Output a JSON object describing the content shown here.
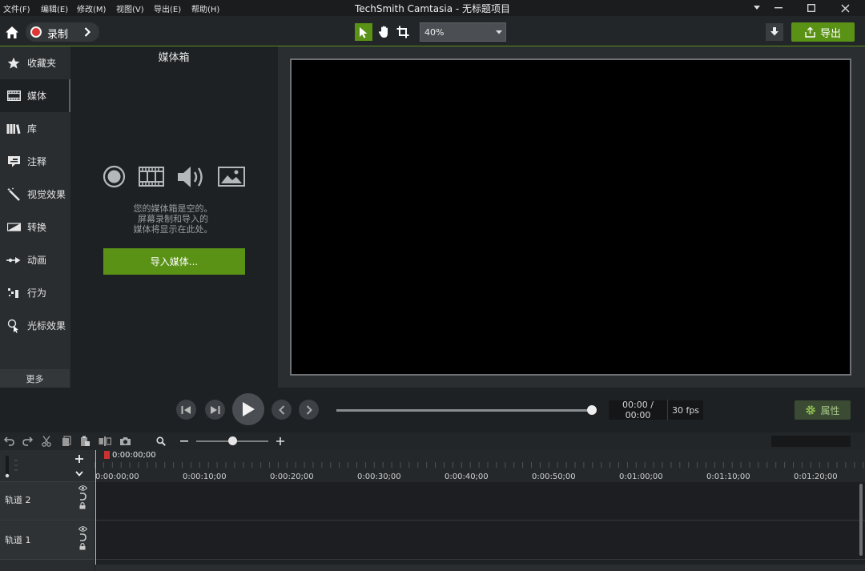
{
  "app": {
    "title": "TechSmith Camtasia - 无标题项目"
  },
  "menu": [
    "文件(F)",
    "编辑(E)",
    "修改(M)",
    "视图(V)",
    "导出(E)",
    "帮助(H)"
  ],
  "toolbar": {
    "record_label": "录制",
    "zoom_value": "40%",
    "export_label": "导出"
  },
  "rail": {
    "items": [
      {
        "label": "收藏夹",
        "icon": "star-icon"
      },
      {
        "label": "媒体",
        "icon": "film-icon"
      },
      {
        "label": "库",
        "icon": "library-icon"
      },
      {
        "label": "注释",
        "icon": "annotation-icon"
      },
      {
        "label": "视觉效果",
        "icon": "magic-wand-icon"
      },
      {
        "label": "转换",
        "icon": "transition-icon"
      },
      {
        "label": "动画",
        "icon": "animation-arrow-icon"
      },
      {
        "label": "行为",
        "icon": "behavior-icon"
      },
      {
        "label": "光标效果",
        "icon": "cursor-effect-icon"
      }
    ],
    "active_index": 1,
    "more_label": "更多"
  },
  "media_bin": {
    "title": "媒体箱",
    "empty_lines": [
      "您的媒体箱是空的。",
      "屏幕录制和导入的",
      "媒体将显示在此处。"
    ],
    "import_label": "导入媒体..."
  },
  "playback": {
    "time": "00:00 / 00:00",
    "fps": "30 fps",
    "properties_label": "属性"
  },
  "timeline": {
    "playhead_time": "0:00:00;00",
    "ticks": [
      "0:00:00;00",
      "0:00:10;00",
      "0:00:20;00",
      "0:00:30;00",
      "0:00:40;00",
      "0:00:50;00",
      "0:01:00;00",
      "0:01:10;00",
      "0:01:20;00"
    ],
    "tracks": [
      {
        "name": "轨道 2"
      },
      {
        "name": "轨道 1"
      }
    ]
  },
  "colors": {
    "accent": "#5a9216",
    "background": "#1e2124",
    "panel": "#2a2d30",
    "record": "#e03535"
  }
}
